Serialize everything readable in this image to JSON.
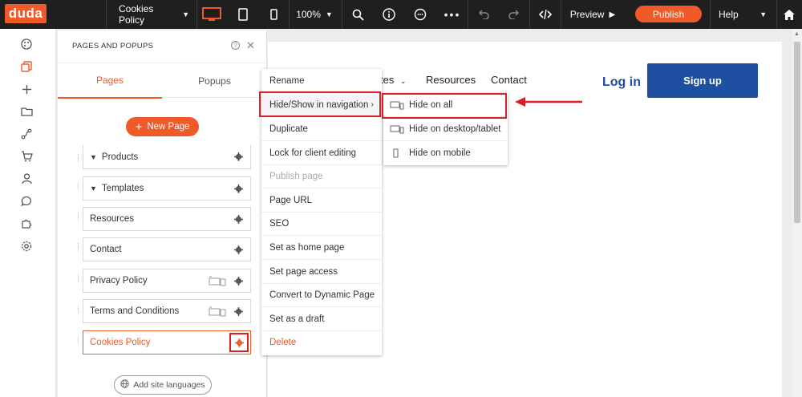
{
  "topbar": {
    "logo": "duda",
    "page_selector": "Cookies Policy",
    "zoom": "100%",
    "preview_label": "Preview",
    "publish_label": "Publish",
    "help_label": "Help"
  },
  "panel": {
    "title": "PAGES AND POPUPS",
    "tabs": [
      "Pages",
      "Popups"
    ],
    "new_page_label": "New Page",
    "pages": [
      {
        "label": "Products"
      },
      {
        "label": "Templates"
      },
      {
        "label": "Resources"
      },
      {
        "label": "Contact"
      },
      {
        "label": "Privacy Policy"
      },
      {
        "label": "Terms and Conditions"
      },
      {
        "label": "Cookies Policy"
      }
    ],
    "add_languages_label": "Add site languages"
  },
  "canvas": {
    "nav": [
      "tes",
      "Resources",
      "Contact"
    ],
    "login_label": "Log in",
    "signup_label": "Sign up"
  },
  "context_menu": {
    "items": [
      "Rename",
      "Hide/Show in navigation",
      "Duplicate",
      "Lock for client editing",
      "Publish page",
      "Page URL",
      "SEO",
      "Set as home page",
      "Set page access",
      "Convert to Dynamic Page",
      "Set as a draft",
      "Delete"
    ]
  },
  "submenu": {
    "items": [
      "Hide on all",
      "Hide on desktop/tablet",
      "Hide on mobile"
    ]
  },
  "colors": {
    "accent": "#f05a28",
    "highlight_red": "#d81f26",
    "brand_blue": "#1e4fa0",
    "topbar": "#1f1f1f"
  }
}
